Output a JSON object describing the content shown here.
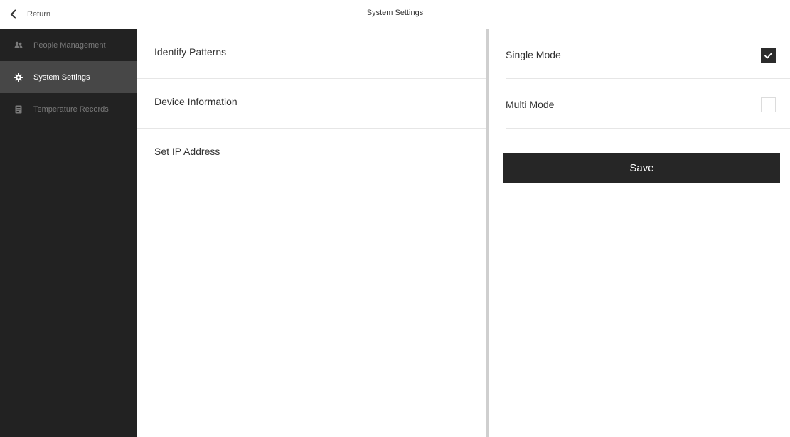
{
  "header": {
    "back_label": "Return",
    "title": "System Settings",
    "back_icon": "chevron-left-icon"
  },
  "sidebar": {
    "items": [
      {
        "label": "People Management",
        "icon": "people-icon",
        "active": false
      },
      {
        "label": "System Settings",
        "icon": "gear-icon",
        "active": true
      },
      {
        "label": "Temperature Records",
        "icon": "document-icon",
        "active": false
      }
    ]
  },
  "middle": {
    "items": [
      {
        "label": "Identify Patterns"
      },
      {
        "label": "Device Information"
      },
      {
        "label": "Set IP Address"
      }
    ]
  },
  "right": {
    "options": [
      {
        "label": "Single Mode",
        "checked": true
      },
      {
        "label": "Multi Mode",
        "checked": false
      }
    ],
    "save_label": "Save"
  },
  "colors": {
    "sidebar_bg": "#222222",
    "sidebar_active_bg": "#474747",
    "button_bg": "#262626",
    "checkbox_checked": "#2b2b2b"
  }
}
